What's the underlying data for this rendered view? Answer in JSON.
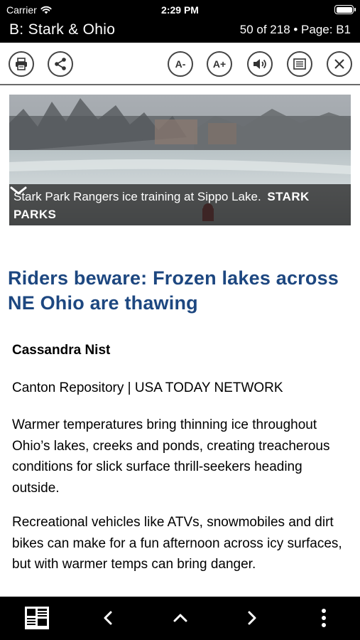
{
  "status_bar": {
    "carrier": "Carrier",
    "time": "2:29 PM",
    "icons": [
      "wifi-icon",
      "battery-icon"
    ]
  },
  "header": {
    "section_title": "B: Stark & Ohio",
    "page_info": "50 of 218 • Page: B1"
  },
  "toolbar": {
    "buttons": [
      {
        "name": "print",
        "icon": "printer-icon"
      },
      {
        "name": "share",
        "icon": "share-icon"
      },
      {
        "name": "font-smaller",
        "label": "A-"
      },
      {
        "name": "font-larger",
        "label": "A+"
      },
      {
        "name": "audio",
        "icon": "speaker-icon"
      },
      {
        "name": "text-view",
        "icon": "article-icon"
      },
      {
        "name": "close",
        "icon": "close-icon"
      }
    ],
    "font_smaller_label": "A-",
    "font_larger_label": "A+"
  },
  "hero": {
    "caption": "Stark Park Rangers ice training at Sippo Lake.",
    "credit": "STARK PARKS",
    "expand_icon": "chevron-down-icon"
  },
  "article": {
    "headline": "Riders beware: Frozen lakes across NE Ohio are thawing",
    "author": "Cassandra Nist",
    "source": "Canton Repository | USA TODAY NETWORK",
    "paragraphs": [
      "Warmer temperatures bring thinning ice throughout Ohio’s lakes, creeks and ponds, creating treacherous conditions for slick surface thrill-seekers heading outside.",
      "Recreational vehicles like ATVs, snowmobiles and dirt bikes can make for a fun afternoon across icy surfaces, but with warmer temps can bring danger."
    ]
  },
  "bottom_bar": {
    "buttons": [
      "newspaper-icon",
      "chevron-left-icon",
      "chevron-up-icon",
      "chevron-right-icon",
      "more-vertical-icon"
    ]
  },
  "colors": {
    "headline": "#1d4780",
    "bars": "#000000",
    "caption_bg": "#282828"
  }
}
